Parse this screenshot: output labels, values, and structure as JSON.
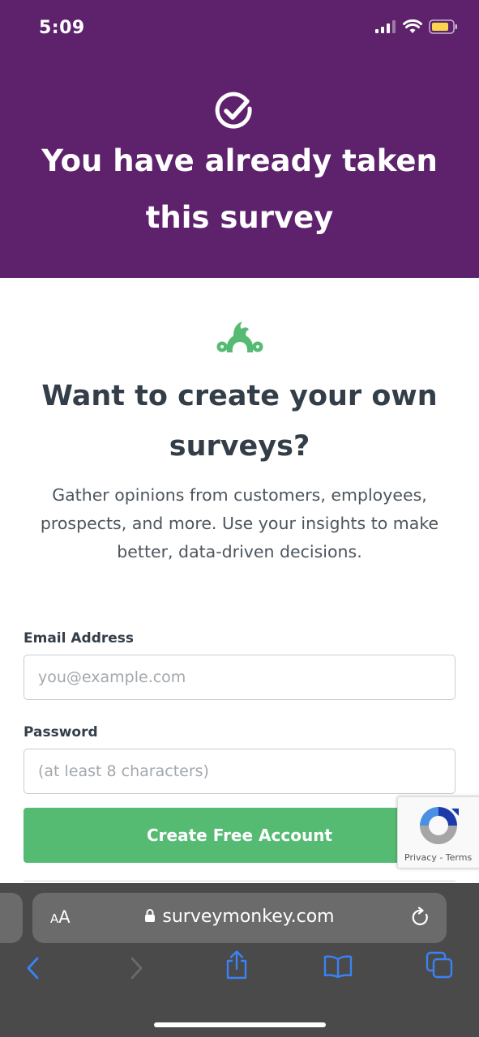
{
  "status_bar": {
    "time": "5:09"
  },
  "hero": {
    "title_line1": "You have already taken",
    "title_line2": "this survey"
  },
  "cta": {
    "title_line1": "Want to create your own",
    "title_line2": "surveys?",
    "desc_line1": "Gather opinions from customers, employees,",
    "desc_line2": "prospects, and more. Use your insights to make",
    "desc_line3": "better, data-driven decisions."
  },
  "form": {
    "email_label": "Email Address",
    "email_placeholder": "you@example.com",
    "password_label": "Password",
    "password_placeholder": "(at least 8 characters)",
    "submit_label": "Create Free Account"
  },
  "recaptcha": {
    "privacy": "Privacy",
    "sep": " - ",
    "terms": "Terms"
  },
  "browser": {
    "aa_small": "A",
    "aa_big": "A",
    "url": "surveymonkey.com"
  },
  "colors": {
    "brand_purple": "#5e226d",
    "brand_green": "#56bb72",
    "browser_dark": "#4a4a4a"
  },
  "icons": [
    "signal-icon",
    "wifi-icon",
    "battery-icon",
    "checkmark-circle-icon",
    "surveymonkey-logo-icon",
    "recaptcha-icon",
    "lock-icon",
    "reload-icon",
    "back-icon",
    "forward-icon",
    "share-icon",
    "bookmarks-icon",
    "tabs-icon"
  ]
}
